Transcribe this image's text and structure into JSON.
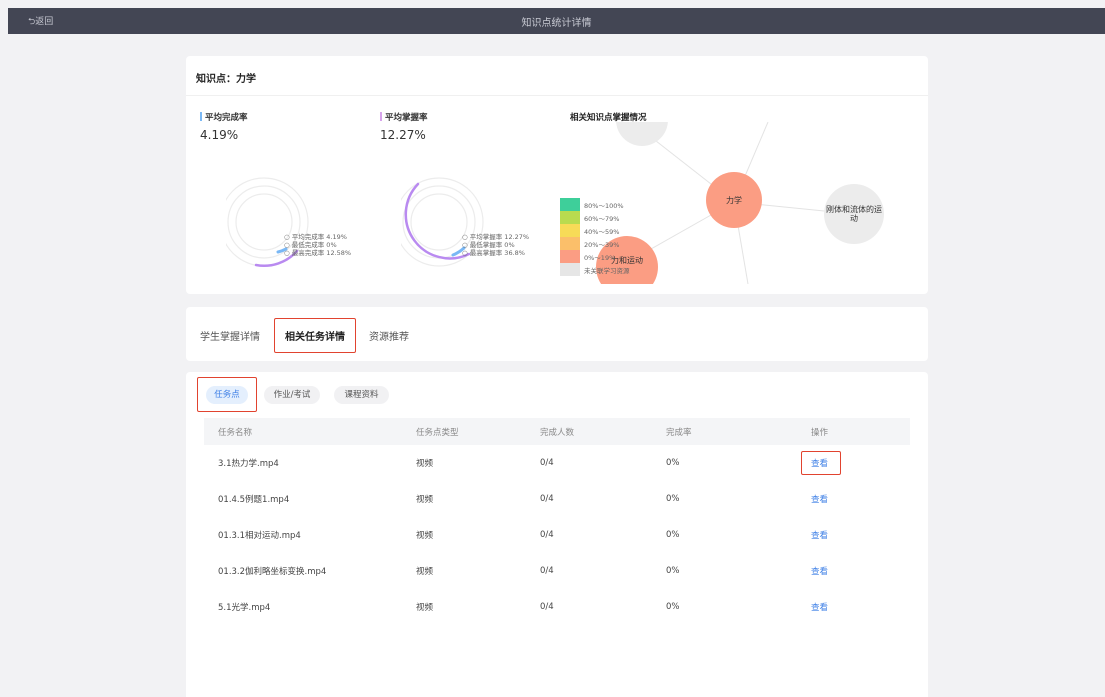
{
  "topbar": {
    "back_label": "⮌返回",
    "title": "知识点统计详情"
  },
  "knowledge": {
    "title": "知识点：力学"
  },
  "completion": {
    "label": "平均完成率",
    "value": "4.19%",
    "legend": [
      "○ 平均完成率 4.19%",
      "○ 最低完成率 0%",
      "○ 最高完成率 12.58%"
    ]
  },
  "mastery": {
    "label": "平均掌握率",
    "value": "12.27%",
    "legend": [
      "○ 平均掌握率 12.27%",
      "○ 最低掌握率 0%",
      "○ 最高掌握率 36.8%"
    ]
  },
  "related": {
    "title": "相关知识点掌握情况",
    "nodes": {
      "center": "力学",
      "right": "刚体和流体的运动",
      "bottom": "力和运动"
    },
    "legend": [
      {
        "label": "80%～100%",
        "color": "#3ecf9a"
      },
      {
        "label": "60%～79%",
        "color": "#b9db4f"
      },
      {
        "label": "40%～59%",
        "color": "#f7db57"
      },
      {
        "label": "20%～39%",
        "color": "#fbbf6a"
      },
      {
        "label": "0%～19%",
        "color": "#fb9d83"
      },
      {
        "label": "未关联学习资源",
        "color": "#e6e6e6"
      }
    ]
  },
  "tabs": [
    "学生掌握详情",
    "相关任务详情",
    "资源推荐"
  ],
  "filters": [
    "任务点",
    "作业/考试",
    "课程资料"
  ],
  "table": {
    "headers": [
      "任务名称",
      "任务点类型",
      "完成人数",
      "完成率",
      "操作"
    ],
    "rows": [
      [
        "3.1热力学.mp4",
        "视频",
        "0/4",
        "0%",
        "查看"
      ],
      [
        "01.4.5例题1.mp4",
        "视频",
        "0/4",
        "0%",
        "查看"
      ],
      [
        "01.3.1相对运动.mp4",
        "视频",
        "0/4",
        "0%",
        "查看"
      ],
      [
        "01.3.2伽利略坐标变换.mp4",
        "视频",
        "0/4",
        "0%",
        "查看"
      ],
      [
        "5.1光学.mp4",
        "视频",
        "0/4",
        "0%",
        "查看"
      ]
    ]
  },
  "colors": {
    "accent": "#3b7ee6",
    "highlight": "#e1432f",
    "completion_ring": "#7ab8f5",
    "mastery_ring": "#b98af0",
    "node": "#fb9d83"
  }
}
